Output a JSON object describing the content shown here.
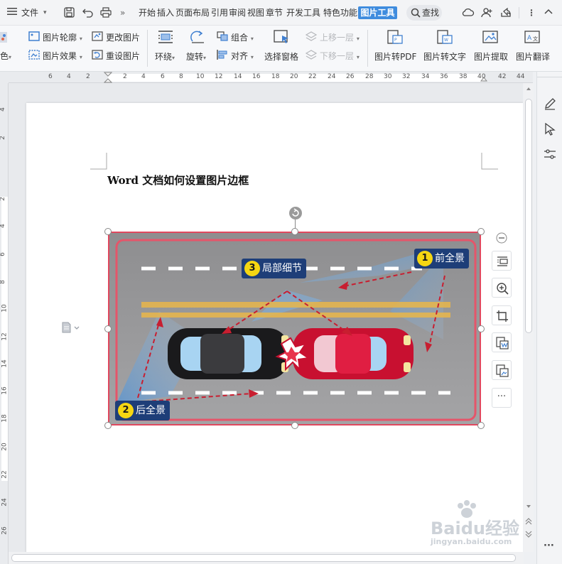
{
  "menubar": {
    "file_label": "文件",
    "tabs": [
      "开始",
      "插入",
      "页面布局",
      "引用",
      "审阅",
      "视图",
      "章节",
      "开发工具",
      "特色功能"
    ],
    "active_tab": "图片工具",
    "search_label": "查找",
    "overflow_label": "»"
  },
  "ribbon": {
    "color_label": "色",
    "picture_outline": "图片轮廓",
    "picture_effect": "图片效果",
    "change_picture": "更改图片",
    "reset_picture": "重设图片",
    "wrap_label": "环绕",
    "rotate_label": "旋转",
    "group_label": "组合",
    "align_label": "对齐",
    "selection_pane": "选择窗格",
    "bring_forward": "上移一层",
    "send_backward": "下移一层",
    "to_pdf": "图片转PDF",
    "to_text": "图片转文字",
    "extract": "图片提取",
    "translate": "图片翻译"
  },
  "ruler": {
    "h_ticks": [
      "6",
      "4",
      "2",
      "2",
      "4",
      "6",
      "8",
      "10",
      "12",
      "14",
      "16",
      "18",
      "20",
      "22",
      "24",
      "26",
      "28",
      "30",
      "32",
      "34",
      "36",
      "38",
      "40",
      "42",
      "44"
    ],
    "v_ticks": [
      "4",
      "2",
      "2",
      "4",
      "6",
      "8",
      "10",
      "12",
      "14",
      "16",
      "18",
      "20",
      "22",
      "24",
      "26"
    ]
  },
  "document": {
    "title": "Word 文档如何设置图片边框"
  },
  "picture": {
    "tag1_num": "1",
    "tag1_label": "前全景",
    "tag2_num": "2",
    "tag2_label": "后全景",
    "tag3_num": "3",
    "tag3_label": "局部细节",
    "border_color": "#e0485e"
  },
  "float_toolbar": {
    "more_label": "···"
  },
  "sidepanel": {
    "more_label": "···"
  },
  "watermark": {
    "brand": "Baidu经验",
    "url": "jingyan.baidu.com"
  },
  "colors": {
    "accent": "#3f8cde",
    "tag_bg": "#1e3e78",
    "tag_num_bg": "#f5d612",
    "border": "#e0485e"
  }
}
